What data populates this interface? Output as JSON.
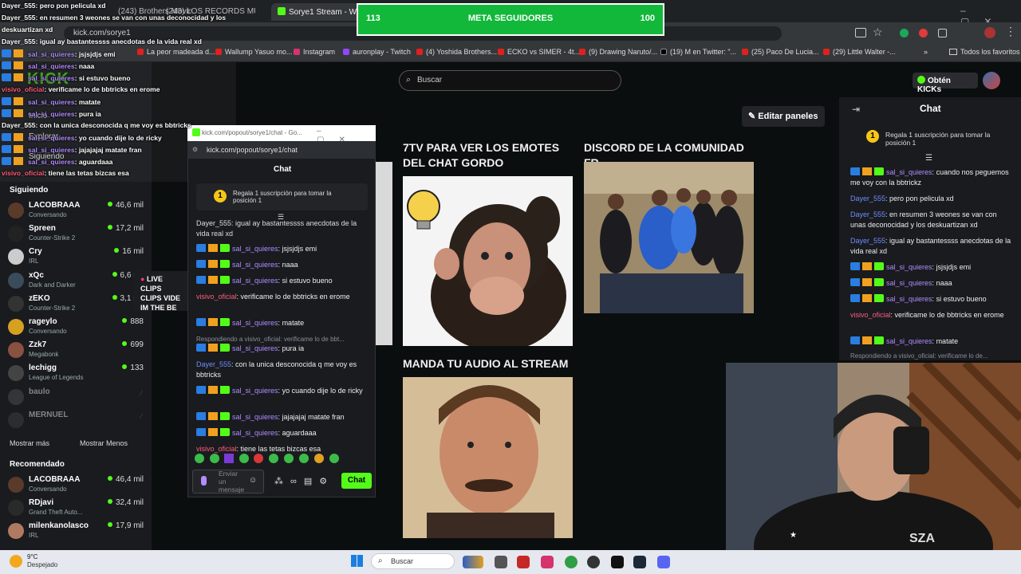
{
  "browser": {
    "tabs": [
      {
        "label": "(243) Brothers Moving 'Minnie'",
        "active": false
      },
      {
        "label": "(243) LOS RECORDS MUNDIALE",
        "active": false
      },
      {
        "label": "Sorye1 Stream - Watch Live",
        "active": true
      }
    ],
    "url": "kick.com/sorye1",
    "bookmarks": [
      "La peor madeada d...",
      "Wallump Yasuo mo...",
      "Instagram",
      "auronplay - Twitch",
      "(4) Yoshida Brothers...",
      "ECKO vs SIMER - 4t...",
      "(9) Drawing Naruto/...",
      "(19) M en Twitter: \"...",
      "(25) Paco De Lucia...",
      "(29) Little Walter -..."
    ],
    "bookmarks_all": "Todos los favoritos"
  },
  "overlay_goal": {
    "left": "113",
    "title": "META SEGUIDORES",
    "right": "100"
  },
  "overlay_chat": [
    {
      "user": "Dayer_555",
      "text": "pero pon pelicula xd"
    },
    {
      "user": "Dayer_555",
      "text": "en resumen 3 weones se van con unas deconocidad y los"
    },
    {
      "user": "",
      "text": "deskuartizan xd"
    },
    {
      "user": "Dayer_555",
      "text": "igual ay bastantessss anecdotas de la vida real xd"
    },
    {
      "user": "sal_si_quieres",
      "text": "jsjsjdjs emi"
    },
    {
      "user": "sal_si_quieres",
      "text": "naaa"
    },
    {
      "user": "sal_si_quieres",
      "text": "si estuvo bueno"
    },
    {
      "user": "visivo_oficial",
      "text": "verificame lo de bbtricks en erome"
    },
    {
      "user": "sal_si_quieres",
      "text": "matate"
    },
    {
      "user": "sal_si_quieres",
      "text": "pura ia"
    },
    {
      "user": "Dayer_555",
      "text": "con la unica desconocida q me voy es bbtricks"
    },
    {
      "user": "sal_si_quieres",
      "text": "yo cuando dije lo de ricky"
    },
    {
      "user": "sal_si_quieres",
      "text": "jajajajaj matate fran"
    },
    {
      "user": "sal_si_quieres",
      "text": "aguardaaa"
    },
    {
      "user": "visivo_oficial",
      "text": "tiene las tetas bizcas esa"
    }
  ],
  "kick": {
    "search_placeholder": "Buscar",
    "get_kicks": "Obtén KICKs",
    "edit_panels": "Editar paneles",
    "following_title": "Siguiendo",
    "following": [
      {
        "name": "LACOBRAAA",
        "sub": "Conversando",
        "count": "46,6 mil"
      },
      {
        "name": "Spreen",
        "sub": "Counter-Strike 2",
        "count": "17,2 mil"
      },
      {
        "name": "Cry",
        "sub": "IRL",
        "count": "16 mil"
      },
      {
        "name": "xQc",
        "sub": "Dark and Darker",
        "count": "6,6 mil"
      },
      {
        "name": "zEKO",
        "sub": "Counter-Strike 2",
        "count": "3,1 mil"
      },
      {
        "name": "rageylo",
        "sub": "Conversando",
        "count": "888"
      },
      {
        "name": "Zzk7",
        "sub": "Megabonk",
        "count": "699"
      },
      {
        "name": "lechigg",
        "sub": "League of Legends",
        "count": "133"
      },
      {
        "name": "baulo",
        "sub": "",
        "count": ""
      },
      {
        "name": "MERNUEL",
        "sub": "",
        "count": ""
      }
    ],
    "show_more": "Mostrar más",
    "show_less": "Mostrar Menos",
    "recommended_title": "Recomendado",
    "recommended": [
      {
        "name": "LACOBRAAA",
        "sub": "Conversando",
        "count": "46,4 mil"
      },
      {
        "name": "RDjavi",
        "sub": "Grand Theft Auto...",
        "count": "32,4 mil"
      },
      {
        "name": "milenkanolasco",
        "sub": "IRL",
        "count": "17,9 mil"
      }
    ],
    "side_labels": {
      "inicio": "Inicio",
      "explorar": "Explorar",
      "siguiendo": "Siguiendo"
    },
    "live_tags": [
      "LIVE",
      "CLIPS",
      "VIDE",
      "IM THE BE"
    ],
    "panels": [
      {
        "title": "7TV PARA VER LOS EMOTES DEL CHAT GORDO"
      },
      {
        "title": "DISCORD DE LA COMUNIDAD FR"
      },
      {
        "title": "MANDA TU AUDIO AL STREAM"
      }
    ],
    "right_chat": {
      "title": "Chat",
      "gift": "Regala 1 suscripción para tomar la posición 1",
      "gift_rank": "1",
      "messages": [
        {
          "user": "sal_si_quieres",
          "text": "cuando nos peguemos me voy con la bbtrickz",
          "color": "purple",
          "badges": true
        },
        {
          "user": "Dayer_555",
          "text": "pero pon pelicula xd",
          "color": "blue",
          "badges": false
        },
        {
          "user": "Dayer_555",
          "text": "en resumen 3 weones se van con unas deconocidad y los deskuartizan xd",
          "color": "blue",
          "badges": false
        },
        {
          "user": "Dayer_555",
          "text": "igual ay bastantessss anecdotas de la vida real xd",
          "color": "blue",
          "badges": false
        },
        {
          "user": "sal_si_quieres",
          "text": "jsjsjdjs emi",
          "color": "purple",
          "badges": true
        },
        {
          "user": "sal_si_quieres",
          "text": "naaa",
          "color": "purple",
          "badges": true
        },
        {
          "user": "sal_si_quieres",
          "text": "si estuvo bueno",
          "color": "purple",
          "badges": true
        },
        {
          "user": "visivo_oficial",
          "text": "verificame lo de bbtricks en erome",
          "color": "red",
          "badges": false
        },
        {
          "user": "sal_si_quieres",
          "text": "matate",
          "color": "purple",
          "badges": true
        }
      ],
      "reply_hint": "Respondiendo a visivo_oficial: verificame lo de..."
    }
  },
  "popout": {
    "title": "kick.com/popout/sorye1/chat - Go...",
    "url": "kick.com/popout/sorye1/chat",
    "chat_title": "Chat",
    "gift": "Regala 1 suscripción para tomar la posición 1",
    "gift_rank": "1",
    "top_text": "Dayer_555: igual ay bastantessss anecdotas de la vida real xd",
    "messages": [
      {
        "user": "sal_si_quieres",
        "text": "jsjsjdjs emi",
        "color": "purple",
        "badges": true
      },
      {
        "user": "sal_si_quieres",
        "text": "naaa",
        "color": "purple",
        "badges": true
      },
      {
        "user": "sal_si_quieres",
        "text": "si estuvo bueno",
        "color": "purple",
        "badges": true
      },
      {
        "user": "visivo_oficial",
        "text": "verificame lo de bbtricks en erome",
        "color": "red",
        "badges": false
      },
      {
        "user": "sal_si_quieres",
        "text": "matate",
        "color": "purple",
        "badges": true
      },
      {
        "reply": "Respondiendo a visivo_oficial: verificame lo de bbt..."
      },
      {
        "user": "sal_si_quieres",
        "text": "pura ia",
        "color": "purple",
        "badges": true
      },
      {
        "user": "Dayer_555",
        "text": "con la unica desconocida q me voy es bbtricks",
        "color": "blue",
        "badges": false
      },
      {
        "user": "sal_si_quieres",
        "text": "yo cuando dije lo de ricky",
        "color": "purple",
        "badges": true
      },
      {
        "user": "sal_si_quieres",
        "text": "jajajajaj matate fran",
        "color": "purple",
        "badges": true
      },
      {
        "user": "sal_si_quieres",
        "text": "aguardaaa",
        "color": "purple",
        "badges": true
      },
      {
        "user": "visivo_oficial",
        "text": "tiene las tetas bizcas esa",
        "color": "red",
        "badges": false
      }
    ],
    "input_placeholder": "Enviar un mensaje",
    "send": "Chat"
  },
  "taskbar": {
    "weather_temp": "9°C",
    "weather_desc": "Despejado",
    "search": "Buscar"
  },
  "webcam_text": "SZA",
  "colors": {
    "kick_green": "#53fc18",
    "meta_green": "#12b83a",
    "purple": "#b38cff",
    "blue": "#6e8cff",
    "red": "#ff5d7d"
  }
}
